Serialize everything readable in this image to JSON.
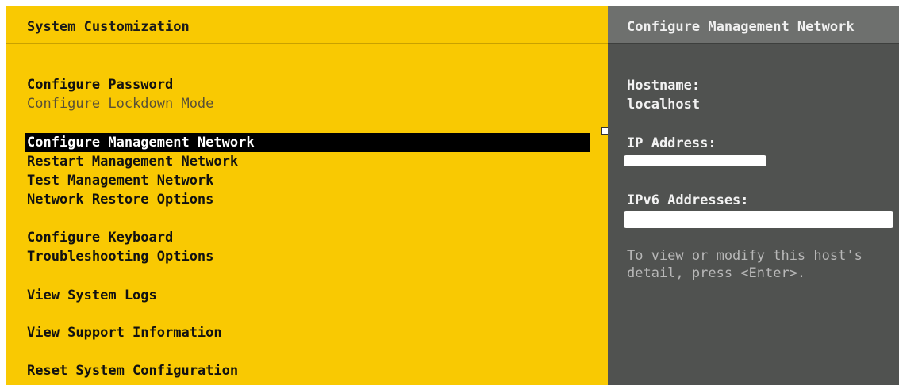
{
  "left_panel": {
    "title": "System Customization",
    "items": [
      {
        "label": "Configure Password",
        "state": "normal"
      },
      {
        "label": "Configure Lockdown Mode",
        "state": "dim"
      },
      {
        "label": "Configure Management Network",
        "state": "selected"
      },
      {
        "label": "Restart Management Network",
        "state": "normal"
      },
      {
        "label": "Test Management Network",
        "state": "normal"
      },
      {
        "label": "Network Restore Options",
        "state": "normal"
      },
      {
        "label": "Configure Keyboard",
        "state": "normal"
      },
      {
        "label": "Troubleshooting Options",
        "state": "normal"
      },
      {
        "label": "View System Logs",
        "state": "normal"
      },
      {
        "label": "View Support Information",
        "state": "normal"
      },
      {
        "label": "Reset System Configuration",
        "state": "normal"
      }
    ]
  },
  "right_panel": {
    "title": "Configure Management Network",
    "hostname_label": "Hostname:",
    "hostname_value": "localhost",
    "ip_label": "IP Address:",
    "ipv6_label": "IPv6 Addresses:",
    "help_line1": "To view or modify this host's",
    "help_line2": "detail, press <Enter>."
  },
  "colors": {
    "left_background": "#f9c902",
    "right_background": "#505250",
    "selection": "#000000"
  }
}
